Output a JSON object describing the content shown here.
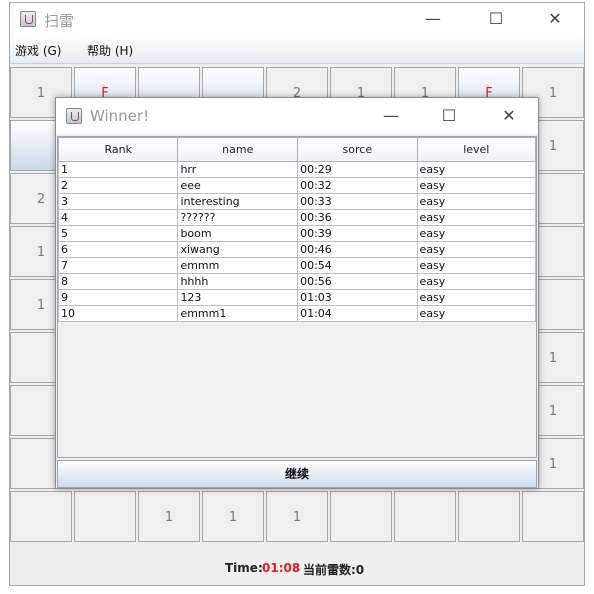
{
  "main_window": {
    "title": "扫雷",
    "minimize": "—",
    "maximize": "☐",
    "close": "✕"
  },
  "menu": [
    "游戏 (G)",
    "帮助 (H)"
  ],
  "board": [
    [
      "1",
      "F",
      "",
      "",
      "2",
      "1",
      "1",
      "F",
      "1"
    ],
    [
      "",
      "",
      "",
      "",
      "",
      "",
      "",
      "",
      "1"
    ],
    [
      "2",
      "",
      "",
      "",
      "",
      "",
      "",
      "",
      ""
    ],
    [
      "1",
      "",
      "",
      "",
      "",
      "",
      "",
      "",
      ""
    ],
    [
      "1",
      "",
      "",
      "",
      "",
      "",
      "",
      "",
      ""
    ],
    [
      "",
      "",
      "",
      "",
      "",
      "",
      "",
      "",
      "1"
    ],
    [
      "",
      "",
      "",
      "",
      "",
      "",
      "",
      "",
      "1"
    ],
    [
      "",
      "",
      "",
      "",
      "",
      "",
      "",
      "",
      "1"
    ],
    [
      "",
      "",
      "1",
      "1",
      "1",
      "",
      "",
      "",
      ""
    ]
  ],
  "status": {
    "time_label": "Time:",
    "time_value": "01:08",
    "mines_label": "当前雷数:0",
    "time_color": "#e41c1c"
  },
  "dialog": {
    "title": "Winner!",
    "minimize": "—",
    "maximize": "☐",
    "close": "✕",
    "columns": [
      "Rank",
      "name",
      "sorce",
      "level"
    ],
    "rows": [
      [
        "1",
        "hrr",
        "00:29",
        "easy"
      ],
      [
        "2",
        "eee",
        "00:32",
        "easy"
      ],
      [
        "3",
        "interesting",
        "00:33",
        "easy"
      ],
      [
        "4",
        "??????",
        "00:36",
        "easy"
      ],
      [
        "5",
        "boom",
        "00:39",
        "easy"
      ],
      [
        "6",
        "xiwang",
        "00:46",
        "easy"
      ],
      [
        "7",
        "emmm",
        "00:54",
        "easy"
      ],
      [
        "8",
        "hhhh",
        "00:56",
        "easy"
      ],
      [
        "9",
        "123",
        "01:03",
        "easy"
      ],
      [
        "10",
        "emmm1",
        "01:04",
        "easy"
      ]
    ],
    "continue_label": "继续"
  }
}
